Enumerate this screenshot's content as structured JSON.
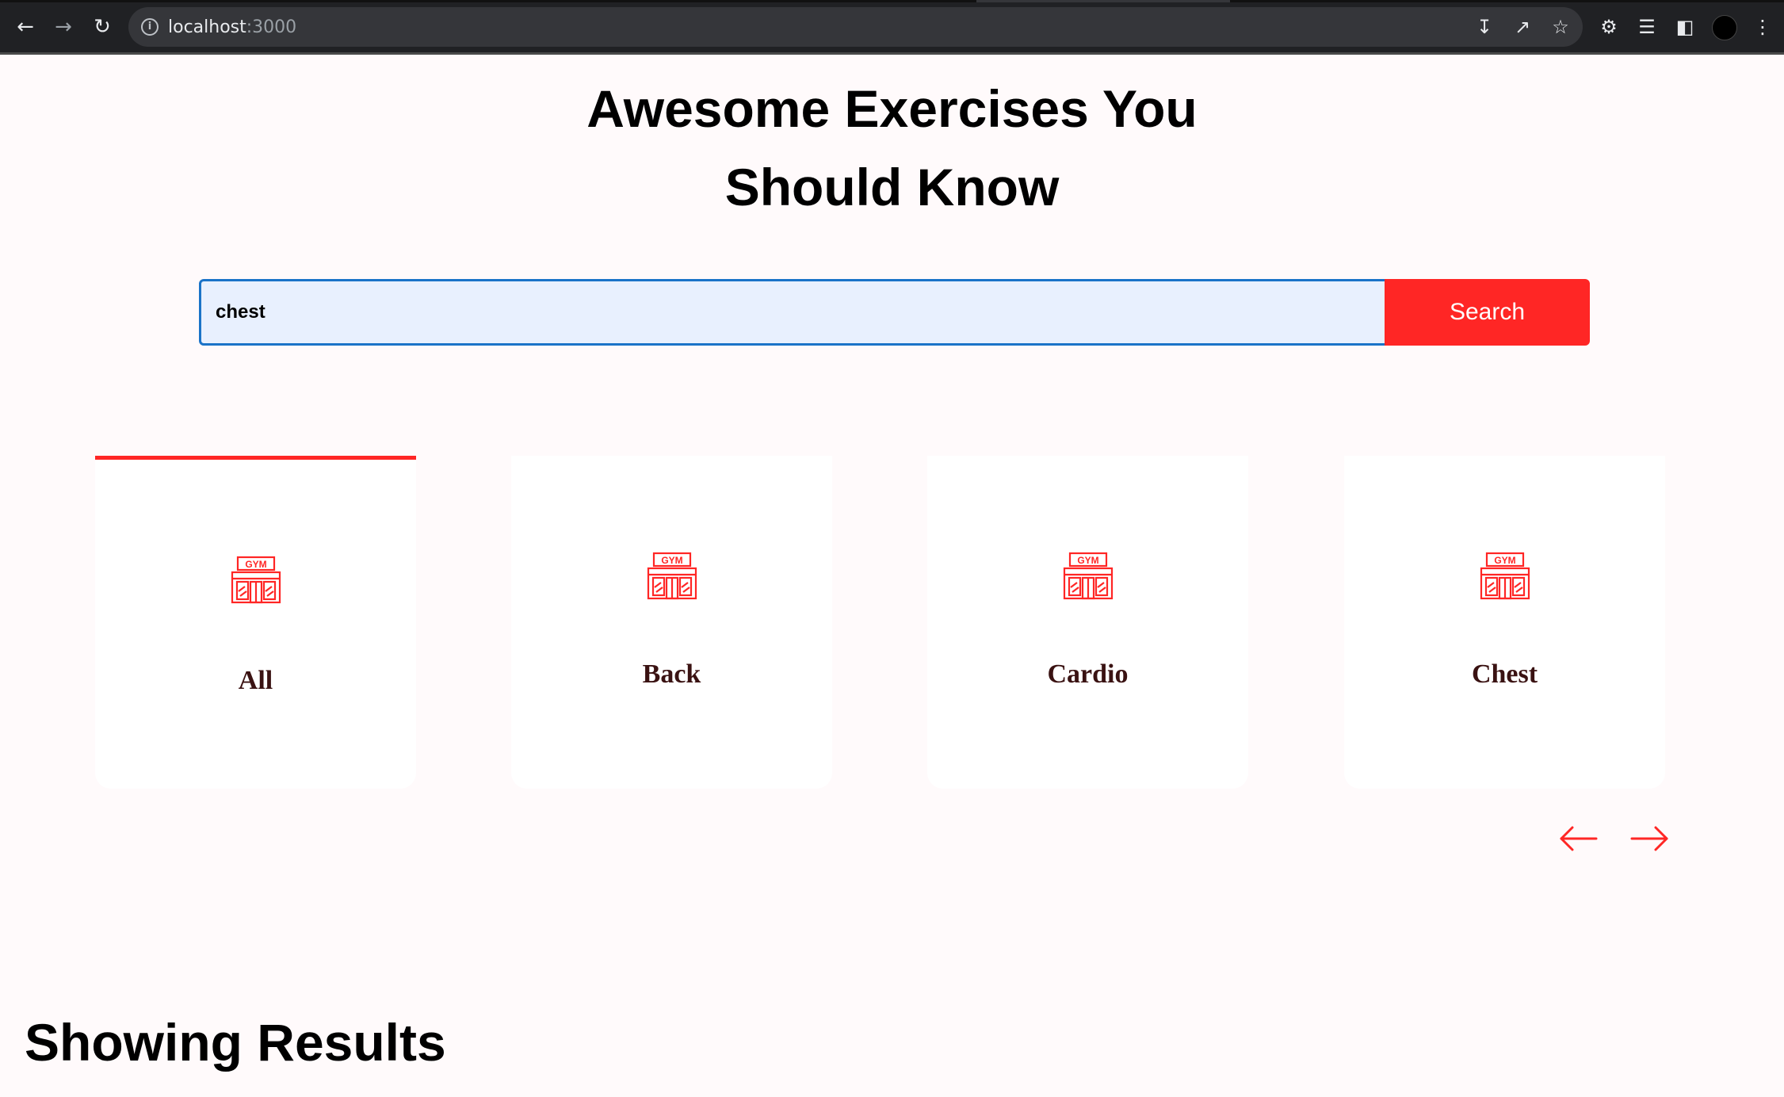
{
  "browser": {
    "url_host": "localhost",
    "url_port": ":3000"
  },
  "hero": {
    "title_line1": "Awesome Exercises You",
    "title_line2": "Should Know"
  },
  "search": {
    "value": "chest",
    "button_label": "Search"
  },
  "categories": {
    "items": [
      {
        "label": "All",
        "icon": "gym-icon",
        "active": true
      },
      {
        "label": "Back",
        "icon": "gym-icon",
        "active": false
      },
      {
        "label": "Cardio",
        "icon": "gym-icon",
        "active": false
      },
      {
        "label": "Chest",
        "icon": "gym-icon",
        "active": false
      }
    ],
    "prev_icon": "left-arrow-icon",
    "next_icon": "right-arrow-icon"
  },
  "results": {
    "heading": "Showing Results"
  },
  "colors": {
    "accent": "#ff2625",
    "card_label": "#3a1212",
    "background": "#fffafb"
  }
}
